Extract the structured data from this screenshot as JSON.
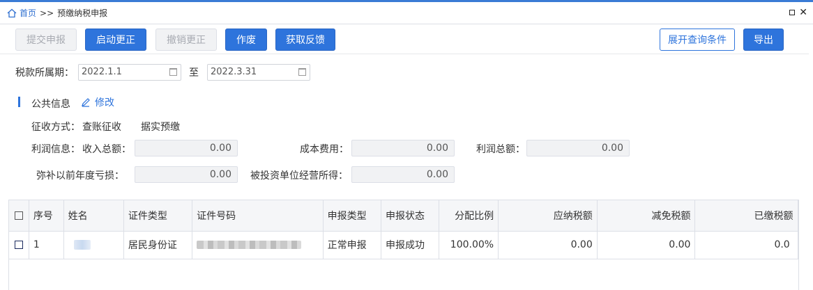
{
  "breadcrumb": {
    "home": "首页",
    "separator": ">>",
    "current": "预缴纳税申报"
  },
  "toolbar": {
    "submit_label": "提交申报",
    "start_correction_label": "启动更正",
    "cancel_correction_label": "撤销更正",
    "void_label": "作废",
    "feedback_label": "获取反馈",
    "expand_query_label": "展开查询条件",
    "export_label": "导出"
  },
  "period": {
    "label": "税款所属期：",
    "from": "2022.1.1",
    "separator": "至",
    "to": "2022.3.31"
  },
  "public_info": {
    "title": "公共信息",
    "edit_label": "修改",
    "collection_method_label": "征收方式：",
    "collection_method_value": "查账征收",
    "prepay_method": "据实预缴",
    "profit_info_label": "利润信息：",
    "income_label": "收入总额：",
    "income_value": "0.00",
    "cost_label": "成本费用：",
    "cost_value": "0.00",
    "profit_label": "利润总额：",
    "profit_value": "0.00",
    "loss_label": "弥补以前年度亏损：",
    "loss_value": "0.00",
    "invest_label": "被投资单位经营所得：",
    "invest_value": "0.00"
  },
  "table": {
    "headers": [
      "序号",
      "姓名",
      "证件类型",
      "证件号码",
      "申报类型",
      "申报状态",
      "分配比例",
      "应纳税额",
      "减免税额",
      "已缴税额"
    ],
    "rows": [
      {
        "index": "1",
        "id_type": "居民身份证",
        "report_type": "正常申报",
        "report_status": "申报成功",
        "ratio": "100.00%",
        "tax_payable": "0.00",
        "tax_relief": "0.00",
        "tax_paid": "0.0"
      }
    ]
  },
  "colors": {
    "primary": "#2e74dc",
    "orange": "#f06a1c"
  }
}
